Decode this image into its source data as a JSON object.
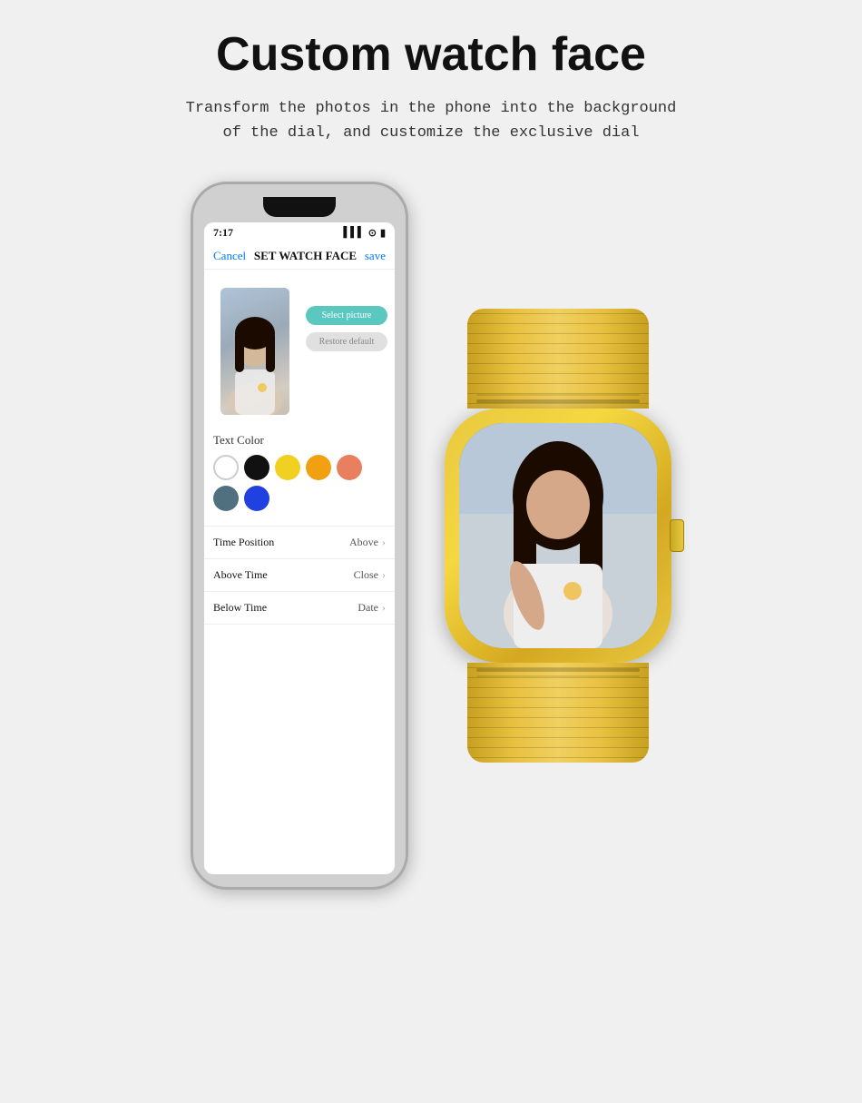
{
  "page": {
    "title": "Custom watch face",
    "subtitle_line1": "Transform the photos in the phone into the background",
    "subtitle_line2": "of the dial, and customize the exclusive dial"
  },
  "phone": {
    "status_time": "7:17",
    "header_cancel": "Cancel",
    "header_title": "SET WATCH FACE",
    "header_save": "save",
    "select_picture_btn": "Select picture",
    "restore_default_btn": "Restore default",
    "text_color_label": "Text Color",
    "colors": [
      {
        "name": "white",
        "class": "circle-white"
      },
      {
        "name": "black",
        "class": "circle-black"
      },
      {
        "name": "yellow",
        "class": "circle-yellow"
      },
      {
        "name": "orange",
        "class": "circle-orange"
      },
      {
        "name": "salmon",
        "class": "circle-salmon"
      },
      {
        "name": "teal",
        "class": "circle-teal"
      },
      {
        "name": "blue",
        "class": "circle-blue"
      }
    ],
    "settings": [
      {
        "label": "Time Position",
        "value": "Above"
      },
      {
        "label": "Above Time",
        "value": "Close"
      },
      {
        "label": "Below Time",
        "value": "Date"
      }
    ]
  }
}
